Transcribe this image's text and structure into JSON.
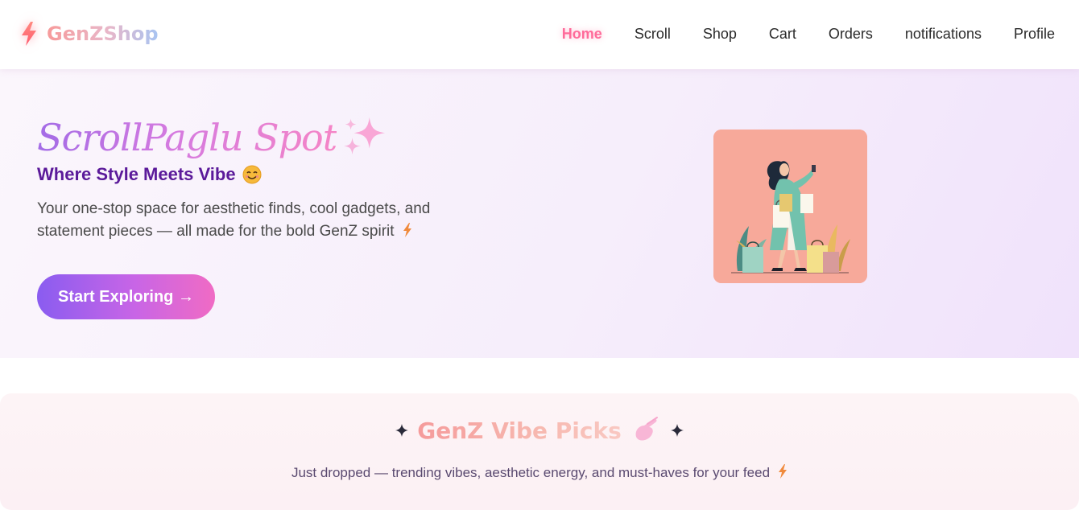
{
  "brand": {
    "name": "GenZShop",
    "logo_icon": "lightning-bolt-icon"
  },
  "nav": {
    "items": [
      {
        "label": "Home",
        "active": true
      },
      {
        "label": "Scroll",
        "active": false
      },
      {
        "label": "Shop",
        "active": false
      },
      {
        "label": "Cart",
        "active": false
      },
      {
        "label": "Orders",
        "active": false
      },
      {
        "label": "notifications",
        "active": false
      },
      {
        "label": "Profile",
        "active": false
      }
    ],
    "active_color": "#ff6b9a"
  },
  "hero": {
    "title": "ScrollPaglu Spot",
    "title_icon": "sparkles-icon",
    "subtitle": "Where Style Meets Vibe",
    "subtitle_icon": "smiling-face-icon",
    "description": "Your one-stop space for aesthetic finds, cool gadgets, and statement pieces — all made for the bold GenZ spirit",
    "description_icon": "lightning-bolt-icon",
    "cta_label": "Start Exploring →",
    "image_icon": "shopping-woman-illustration"
  },
  "picks": {
    "title": "GenZ Vibe Picks",
    "title_icons": [
      "sparkle-icon",
      "pointing-hand-icon",
      "sparkle-icon"
    ],
    "description": "Just dropped — trending vibes, aesthetic energy, and must-haves for your feed",
    "description_icon": "lightning-bolt-icon"
  },
  "colors": {
    "accent_purple": "#8a5cf0",
    "accent_pink": "#f06bc4",
    "subtitle_purple": "#5b1a9a",
    "picks_coral": "#f59b9b"
  }
}
